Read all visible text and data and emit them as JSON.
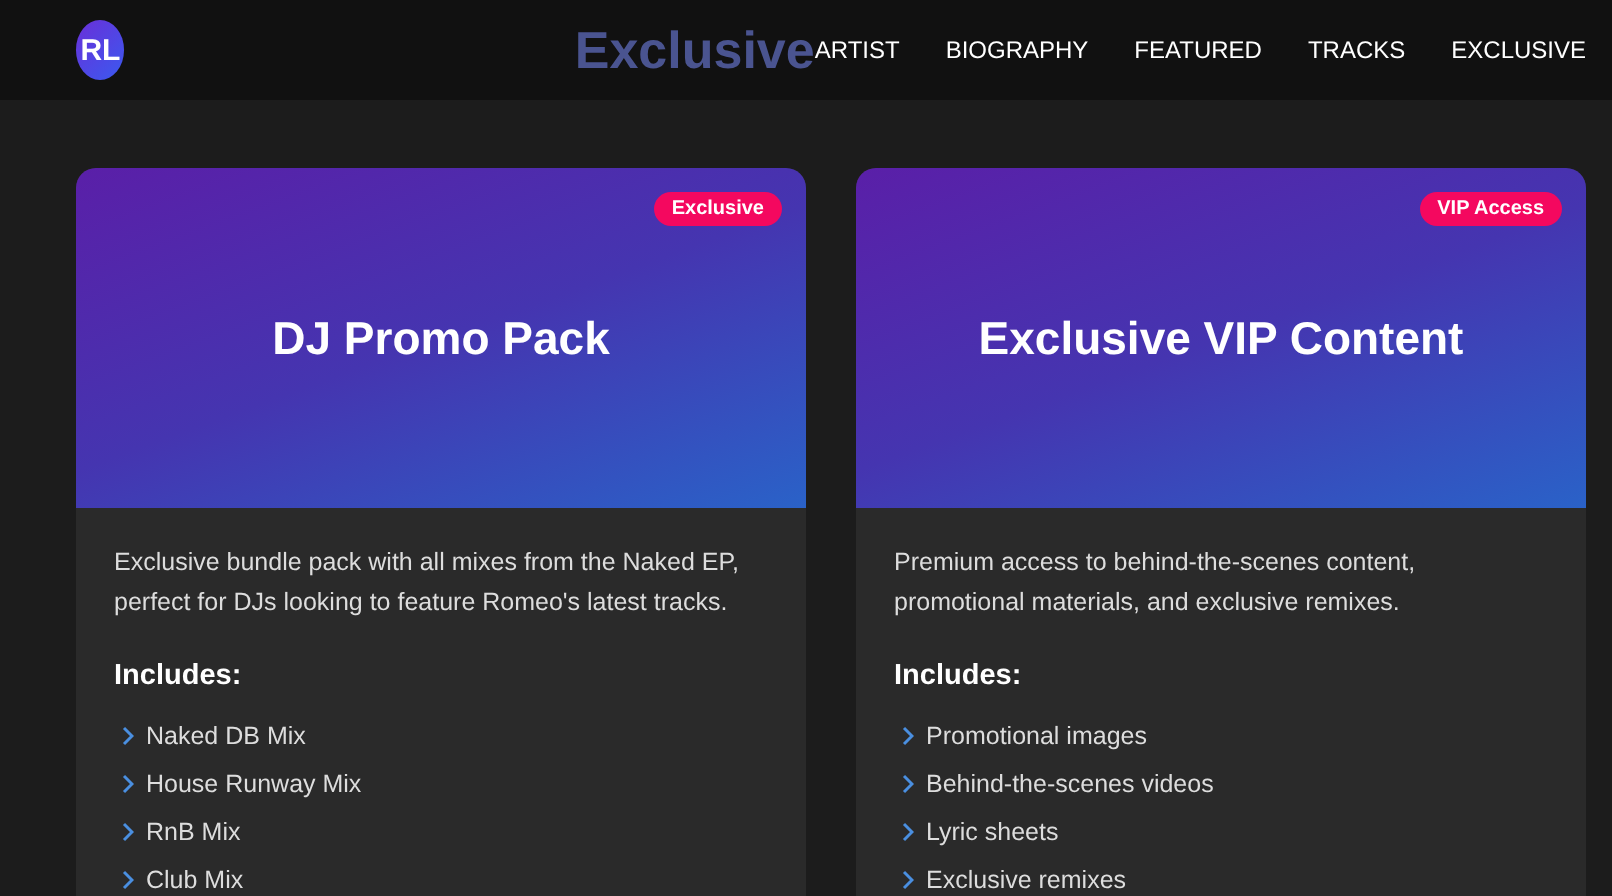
{
  "header": {
    "logo": "RL",
    "page_title": "Exclusive",
    "nav": [
      {
        "label": "ARTIST"
      },
      {
        "label": "BIOGRAPHY"
      },
      {
        "label": "FEATURED"
      },
      {
        "label": "TRACKS"
      },
      {
        "label": "EXCLUSIVE"
      }
    ]
  },
  "cards": [
    {
      "badge": "Exclusive",
      "title": "DJ Promo Pack",
      "description": "Exclusive bundle pack with all mixes from the Naked EP, perfect for DJs looking to feature Romeo's latest tracks.",
      "includes_heading": "Includes:",
      "items": [
        "Naked DB Mix",
        "House Runway Mix",
        "RnB Mix",
        "Club Mix"
      ]
    },
    {
      "badge": "VIP Access",
      "title": "Exclusive VIP Content",
      "description": "Premium access to behind-the-scenes content, promotional materials, and exclusive remixes.",
      "includes_heading": "Includes:",
      "items": [
        "Promotional images",
        "Behind-the-scenes videos",
        "Lyric sheets",
        "Exclusive remixes"
      ]
    }
  ]
}
